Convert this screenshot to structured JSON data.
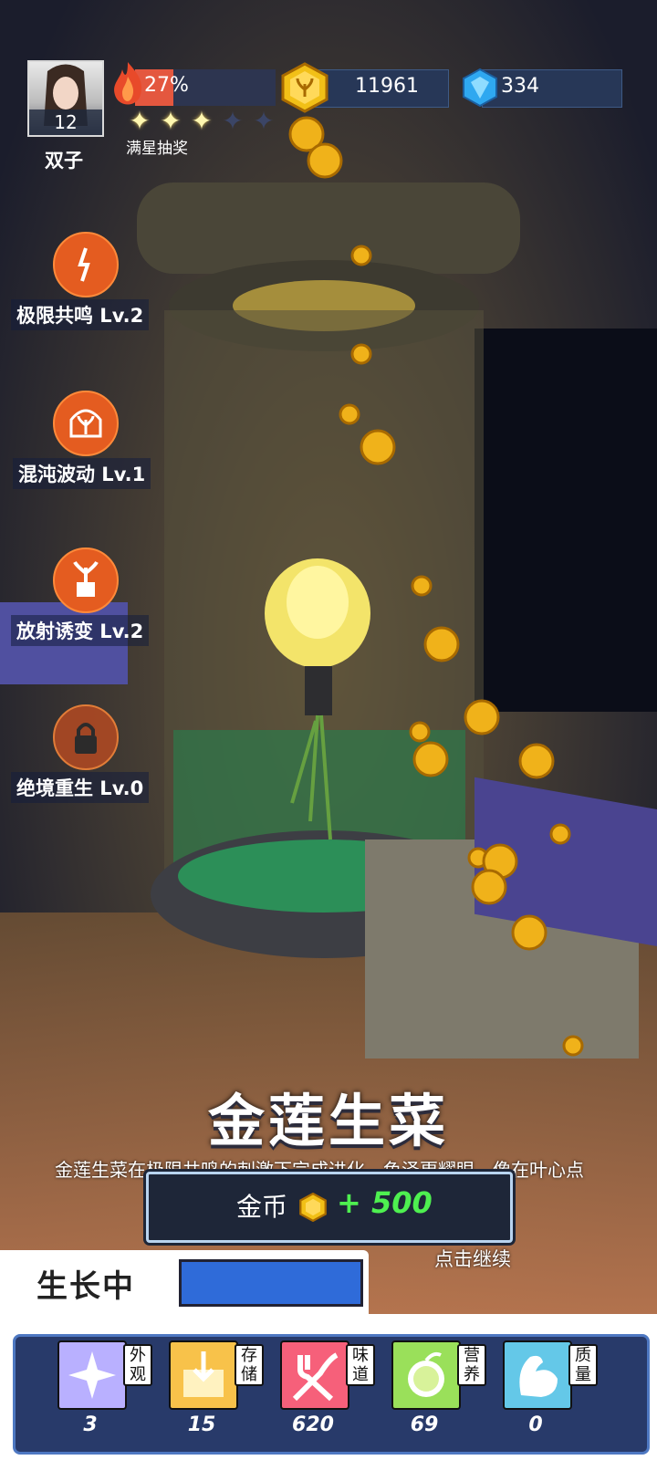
{
  "player": {
    "name": "双子",
    "level": "12",
    "progress": "27%",
    "progress_fraction": 0.27,
    "stars_filled": 3,
    "stars_total": 5,
    "stars_label": "满星抽奖"
  },
  "resources": {
    "coins": "11961",
    "gems": "334"
  },
  "skills": [
    {
      "label": "极限共鸣 Lv.2",
      "icon": "lightning-leaf-icon"
    },
    {
      "label": "混沌波动 Lv.1",
      "icon": "plant-dome-icon"
    },
    {
      "label": "放射诱变 Lv.2",
      "icon": "seedling-box-icon"
    },
    {
      "label": "绝境重生 Lv.0",
      "icon": "lock-icon"
    }
  ],
  "plant": {
    "name": "金莲生菜",
    "description": "金莲生菜在极限共鸣的刺激下完成进化，色泽更耀眼，像在叶心点"
  },
  "reward": {
    "label": "金币",
    "amount": "+ 500"
  },
  "continue_label": "点击继续",
  "growth": {
    "tab_label": "生长中"
  },
  "stats": [
    {
      "tag": "外观",
      "value": "3",
      "color": "#b9b0ff",
      "icon": "sparkle-icon"
    },
    {
      "tag": "存储",
      "value": "15",
      "color": "#f8c24a",
      "icon": "box-icon"
    },
    {
      "tag": "味道",
      "value": "620",
      "color": "#f6607a",
      "icon": "fork-icon"
    },
    {
      "tag": "营养",
      "value": "69",
      "color": "#9ae05a",
      "icon": "lemon-icon"
    },
    {
      "tag": "质量",
      "value": "0",
      "color": "#64c8e8",
      "icon": "muscle-icon"
    }
  ],
  "colors": {
    "accent": "#e45c20",
    "panel": "#283a6a",
    "reward_green": "#4ef050"
  }
}
